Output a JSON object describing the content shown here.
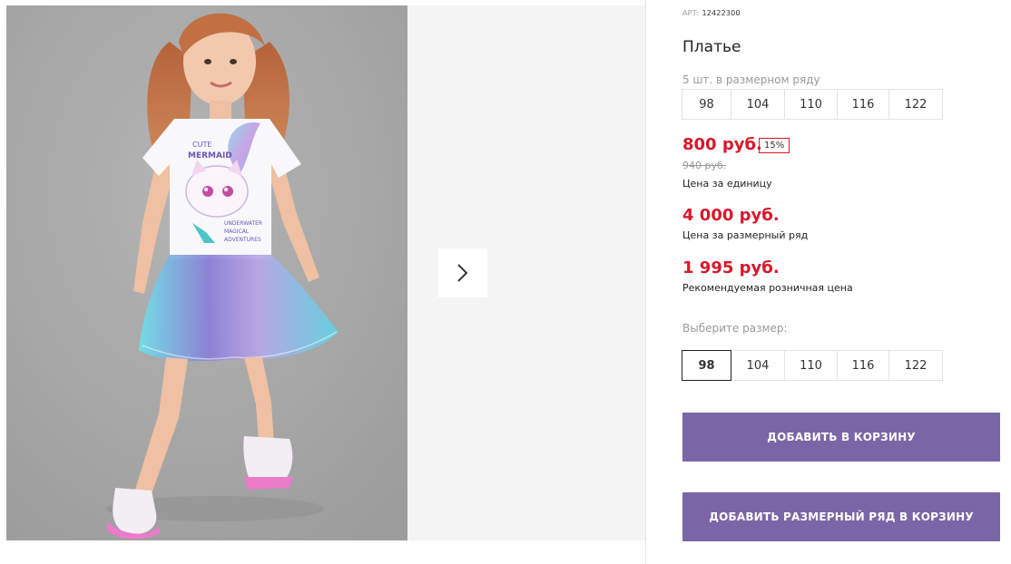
{
  "product": {
    "sku_label": "АРТ:",
    "sku": "12422300",
    "title": "Платье"
  },
  "pack": {
    "label": "5 шт. в размерном ряду",
    "sizes": [
      "98",
      "104",
      "110",
      "116",
      "122"
    ]
  },
  "prices": {
    "unit_price": "800 руб.",
    "discount": "15%",
    "old_price": "940 руб.",
    "unit_caption": "Цена за единицу",
    "pack_price": "4 000 руб.",
    "pack_caption": "Цена за размерный ряд",
    "retail_price": "1 995 руб.",
    "retail_caption": "Рекомендуемая розничная цена"
  },
  "size_select": {
    "label": "Выберите размер:",
    "sizes": [
      "98",
      "104",
      "110",
      "116",
      "122"
    ],
    "selected": "98"
  },
  "buttons": {
    "add_to_cart": "ДОБАВИТЬ В КОРЗИНУ",
    "add_pack_to_cart": "ДОБАВИТЬ РАЗМЕРНЫЙ РЯД В КОРЗИНУ"
  },
  "printed_art": {
    "line1": "CUTE",
    "line2": "MERMAID",
    "line3": "UNDERWATER",
    "line4": "MAGICAL",
    "line5": "ADVENTURES"
  },
  "colors": {
    "price_red": "#d9182b",
    "button_purple": "#7a66a6",
    "gallery_bg": "#f4f4f4",
    "photo_bg": "#a9a9a9"
  }
}
